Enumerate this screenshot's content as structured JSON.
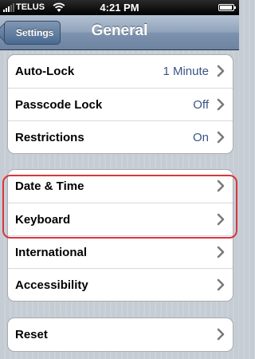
{
  "status_bar": {
    "carrier": "TELUS",
    "time": "4:21 PM"
  },
  "nav": {
    "back_label": "Settings",
    "title": "General"
  },
  "groups": [
    {
      "rows": [
        {
          "label": "Auto-Lock",
          "value": "1 Minute"
        },
        {
          "label": "Passcode Lock",
          "value": "Off"
        },
        {
          "label": "Restrictions",
          "value": "On"
        }
      ]
    },
    {
      "rows": [
        {
          "label": "Date & Time",
          "value": ""
        },
        {
          "label": "Keyboard",
          "value": ""
        },
        {
          "label": "International",
          "value": ""
        },
        {
          "label": "Accessibility",
          "value": ""
        }
      ]
    },
    {
      "rows": [
        {
          "label": "Reset",
          "value": ""
        }
      ]
    }
  ],
  "highlighted_row": "Keyboard",
  "colors": {
    "value_text": "#385487",
    "highlight": "#d9363e"
  },
  "icons": {
    "row_disclosure": "chevron-right-icon",
    "wifi": "wifi-icon",
    "battery": "battery-icon",
    "signal": "signal-strength-icon"
  }
}
